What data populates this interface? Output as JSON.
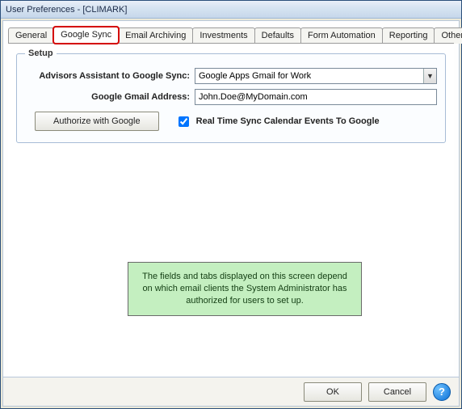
{
  "window": {
    "title": "User Preferences -   [CLIMARK]"
  },
  "tabs": {
    "general": "General",
    "google_sync": "Google Sync",
    "email_archiving": "Email Archiving",
    "investments": "Investments",
    "defaults": "Defaults",
    "form_automation": "Form Automation",
    "reporting": "Reporting",
    "other_passwords": "Other Passwords"
  },
  "setup": {
    "legend": "Setup",
    "aa_to_google_label": "Advisors Assistant to Google Sync:",
    "aa_to_google_value": "Google Apps Gmail for Work",
    "gmail_label": "Google Gmail Address:",
    "gmail_value": "John.Doe@MyDomain.com",
    "authorize_btn": "Authorize with Google",
    "realtime_label": "Real Time Sync Calendar Events To Google",
    "realtime_checked": true
  },
  "note": "The fields and tabs displayed on this screen depend on which email clients the System Administrator has authorized for users to set up.",
  "footer": {
    "ok": "OK",
    "cancel": "Cancel",
    "help": "?"
  }
}
